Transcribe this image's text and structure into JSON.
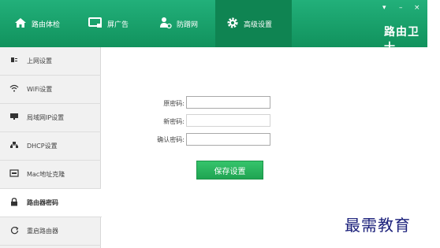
{
  "tabs": [
    {
      "label": "路由体检",
      "icon": "home-icon"
    },
    {
      "label": "屏广告",
      "icon": "monitor-icon"
    },
    {
      "label": "防蹭网",
      "icon": "user-block-icon"
    },
    {
      "label": "高级设置",
      "icon": "gear-icon",
      "active": true
    }
  ],
  "brand": "路由卫士",
  "window_controls": {
    "menu": "▾",
    "minimize": "–",
    "close": "×"
  },
  "sidebar": [
    {
      "label": "上网设置",
      "icon": "plug-icon"
    },
    {
      "label": "WiFi设置",
      "icon": "wifi-icon"
    },
    {
      "label": "局域网IP设置",
      "icon": "lan-icon"
    },
    {
      "label": "DHCP设置",
      "icon": "dhcp-icon"
    },
    {
      "label": "Mac地址克隆",
      "icon": "mac-icon"
    },
    {
      "label": "路由器密码",
      "icon": "lock-icon",
      "active": true
    },
    {
      "label": "重启路由器",
      "icon": "restart-icon"
    }
  ],
  "form": {
    "old_password_label": "原密码:",
    "new_password_label": "新密码:",
    "confirm_password_label": "确认密码:",
    "old_password_value": "",
    "new_password_value": "",
    "confirm_password_value": "",
    "save_label": "保存设置"
  },
  "watermark": "最需教育",
  "colors": {
    "accent": "#11925d",
    "button": "#20a452"
  }
}
